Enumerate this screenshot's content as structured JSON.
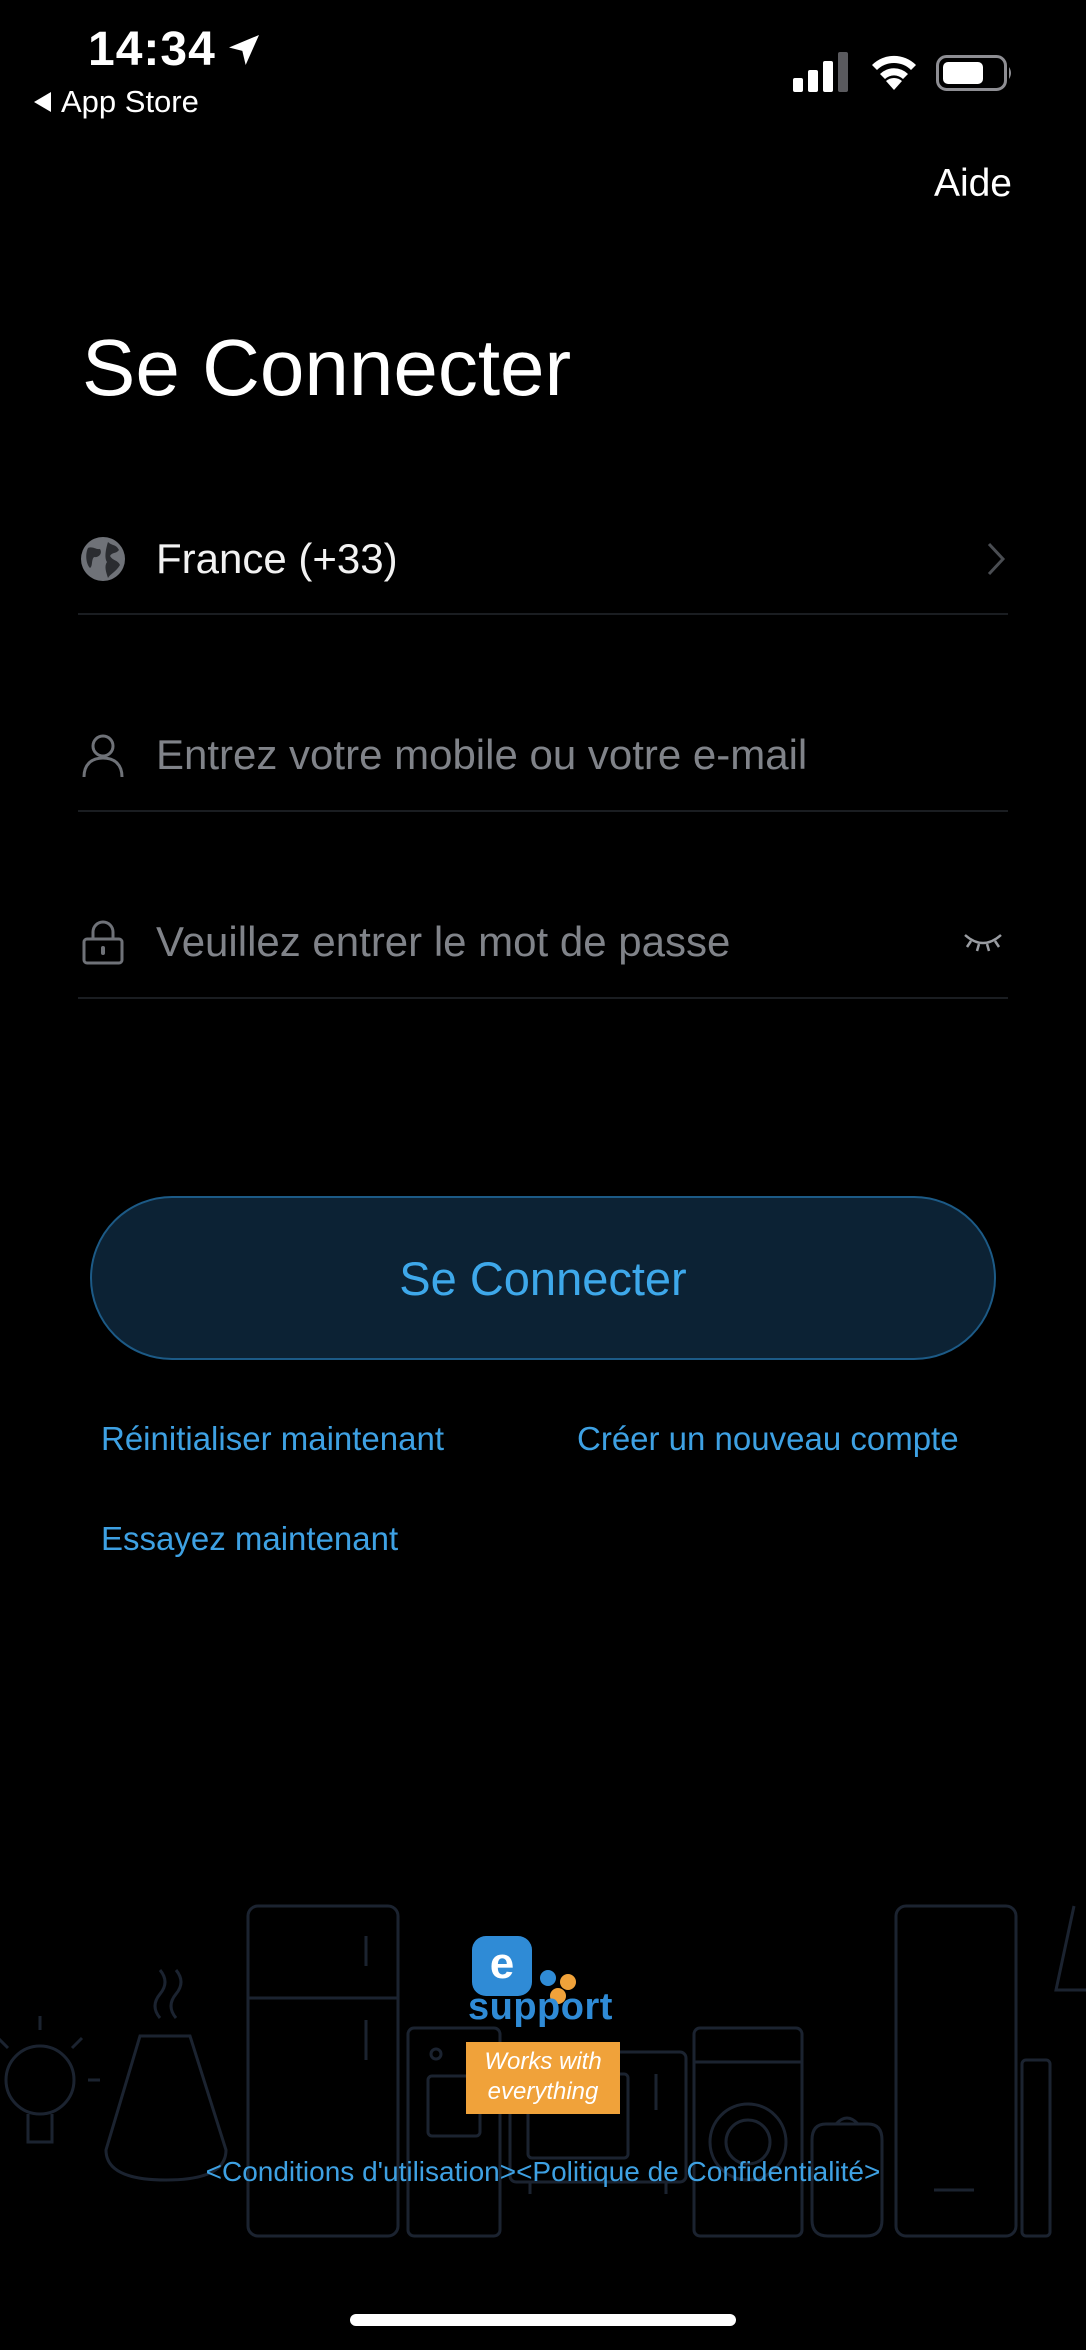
{
  "status_bar": {
    "time": "14:34",
    "back_label": "App Store",
    "icons": [
      "location-arrow-icon",
      "cellular-signal-icon",
      "wifi-icon",
      "battery-icon"
    ]
  },
  "header": {
    "help": "Aide",
    "title": "Se Connecter"
  },
  "form": {
    "country": "France (+33)",
    "account_placeholder": "Entrez votre mobile ou votre e-mail",
    "account_value": "",
    "password_placeholder": "Veuillez entrer le mot de passe",
    "password_value": ""
  },
  "actions": {
    "login": "Se Connecter",
    "reset": "Réinitialiser maintenant",
    "create": "Créer un nouveau compte",
    "try": "Essayez maintenant"
  },
  "badge": {
    "logo_letter": "e",
    "word": "support",
    "line1": "Works with",
    "line2": "everything"
  },
  "legal": "<Conditions d'utilisation><Politique de Confidentialité>",
  "colors": {
    "accent": "#3ea1e3",
    "button_bg": "#0c2234",
    "badge_orange": "#f0a23a",
    "logo_blue": "#2f8bd6"
  }
}
